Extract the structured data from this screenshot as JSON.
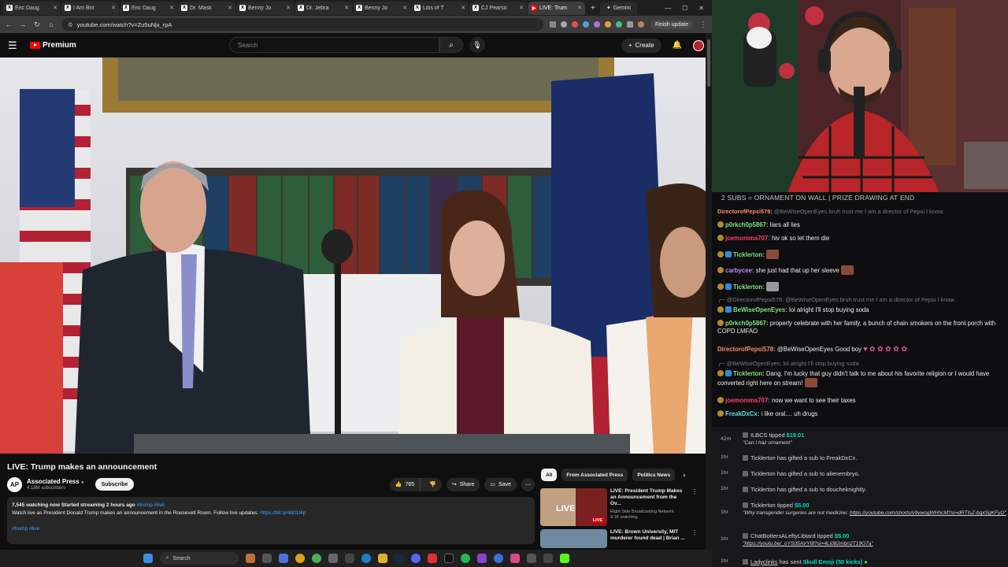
{
  "browser": {
    "tabs": [
      {
        "label": "Eric Daug",
        "active": false
      },
      {
        "label": "I Am Brit",
        "active": false
      },
      {
        "label": "Eric Daug",
        "active": false
      },
      {
        "label": "Dr. Mask",
        "active": false
      },
      {
        "label": "Benny Jo",
        "active": false
      },
      {
        "label": "Dr. Jebra",
        "active": false
      },
      {
        "label": "Benny Jo",
        "active": false
      },
      {
        "label": "Libs of T",
        "active": false
      },
      {
        "label": "CJ Pearso",
        "active": false
      },
      {
        "label": "LIVE: Trum",
        "active": true
      }
    ],
    "gemini_label": "Gemini",
    "url": "youtube.com/watch?v=Zu5uNjx_rpA",
    "finish_update": "Finish update"
  },
  "youtube": {
    "logo_text": "Premium",
    "search_placeholder": "Search",
    "create_label": "Create",
    "video_title": "LIVE: Trump makes an announcement",
    "channel": {
      "avatar_text": "AP",
      "name": "Associated Press",
      "subscribers": "4.18M subscribers",
      "subscribe_label": "Subscribe"
    },
    "actions": {
      "likes": "765",
      "share": "Share",
      "save": "Save"
    },
    "description": {
      "stats": "7,545 watching now  Started streaming 2 hours ago",
      "tags_inline": "#trump #live",
      "text": "Watch live as President Donald Trump makes an announcement in the Roosevelt Room. Follow live updates:",
      "link": "https://bit.ly/4b01t4p",
      "tags": "#trump #live"
    },
    "chips": [
      "All",
      "From Associated Press",
      "Politics News"
    ],
    "recommended": [
      {
        "title_line1": "LIVE: President Trump Makes",
        "title_line2": "an Announcement from the Ov...",
        "channel": "Right Side Broadcasting Network",
        "meta": "9.1K watching",
        "badge": "LIVE",
        "thumb_text": "LIVE"
      },
      {
        "title_line1": "LIVE: Brown University, MIT",
        "title_line2": "murderer found dead | Brian ...",
        "channel": "",
        "meta": "",
        "badge": "",
        "thumb_text": ""
      }
    ]
  },
  "stream": {
    "banner": "2 SUBS = ORNAMENT ON WALL | PRIZE DRAWING AT END",
    "chat": [
      {
        "user": "DirectorofPepsi578:",
        "text": "@BeWiseOpenEyes bruh trust me I am a director of Pepsi I know.",
        "color": "#ff8a65",
        "dim": true
      },
      {
        "user": "p0rkch0p5867:",
        "text": "liars all lies",
        "color": "#7fe07f",
        "dim": false
      },
      {
        "user": "joemomma707:",
        "text": "hiv ok so let them die",
        "color": "#ff3f6c",
        "dim": false
      },
      {
        "user": "Ticklerton:",
        "text": "",
        "color": "#7fe07f",
        "dim": false
      },
      {
        "user": "carbycee:",
        "text": "she just had that up her sleeve",
        "color": "#c58af9",
        "dim": false
      },
      {
        "user": "Ticklerton:",
        "text": "",
        "color": "#7fe07f",
        "dim": false
      },
      {
        "user": "@DirectorofPepsi578:",
        "text": "@BeWiseOpenEyes bruh trust me I am a director of Pepsi I know.",
        "color": "#7a7a7f",
        "dim": true
      },
      {
        "user": "BeWiseOpenEyes:",
        "text": "lol alright I'll stop buying soda",
        "color": "#7fe07f",
        "dim": false
      },
      {
        "user": "p0rkch0p5867:",
        "text": "properly celebrate with her family, a bunch of chain smokers on the front porch with COPD LMFAO",
        "color": "#7fe07f",
        "dim": false
      },
      {
        "user": "DirectorofPepsi578:",
        "text": "@BeWiseOpenEyes Good boy",
        "color": "#ff8a65",
        "dim": false
      },
      {
        "user": "@BeWiseOpenEyes:",
        "text": "lol alright I'll stop buying soda",
        "color": "#7a7a7f",
        "dim": true
      },
      {
        "user": "Ticklerton:",
        "text": "Dang. I'm lucky that guy didn't talk to me about his favorite religion or I would have converted right here on stream!",
        "color": "#7fe07f",
        "dim": false
      },
      {
        "user": "joemomma707:",
        "text": "now we want to see their taxes",
        "color": "#ff3f6c",
        "dim": false
      },
      {
        "user": "FreakDxCx:",
        "text": "i like oral.... uh drugs",
        "color": "#5fe0e0",
        "dim": false
      }
    ],
    "alerts": [
      {
        "time": "42m",
        "user": "ILBCS",
        "action": "tipped",
        "amount": "$19.01",
        "note": "\"Can I haz ornament\"",
        "link": ""
      },
      {
        "time": "1hr",
        "user": "Ticklerton",
        "action": "has gifted a sub to",
        "amount": "",
        "target": "FreakDxCx.",
        "note": "",
        "link": ""
      },
      {
        "time": "1hr",
        "user": "Ticklerton",
        "action": "has gifted a sub to",
        "amount": "",
        "target": "alienembryo.",
        "note": "",
        "link": ""
      },
      {
        "time": "1hr",
        "user": "Ticklerton",
        "action": "has gifted a sub to",
        "amount": "",
        "target": "doucheknightly.",
        "note": "",
        "link": ""
      },
      {
        "time": "1hr",
        "user": "Ticklerton",
        "action": "tipped",
        "amount": "$5.00",
        "note": "\"Why transgender surgeries are not medicine:",
        "link": "https://youtube.com/shorts/v9ywogWHhcM?si=dRTIsZ-bgxSgKFyQ\""
      },
      {
        "time": "1hr",
        "user": "ChatBottersALeftyLibtard",
        "action": "tipped",
        "amount": "$5.00",
        "note": "",
        "link": "\"https://youtu.be/_oYS05AVYI8?si=4Li082mbn2T19G7a\""
      },
      {
        "time": "1hr",
        "user": "Ladyclinks",
        "action": "has sent",
        "amount": "",
        "gift": "Skull Emoji (50 kicks)",
        "note": "",
        "link": ""
      }
    ]
  },
  "taskbar": {
    "search_label": "Search"
  },
  "colors": {
    "yt_red": "#ff0000",
    "chat_bg": "#0e0e10",
    "alert_bg": "#18181b",
    "tip_green": "#00e0c0"
  }
}
